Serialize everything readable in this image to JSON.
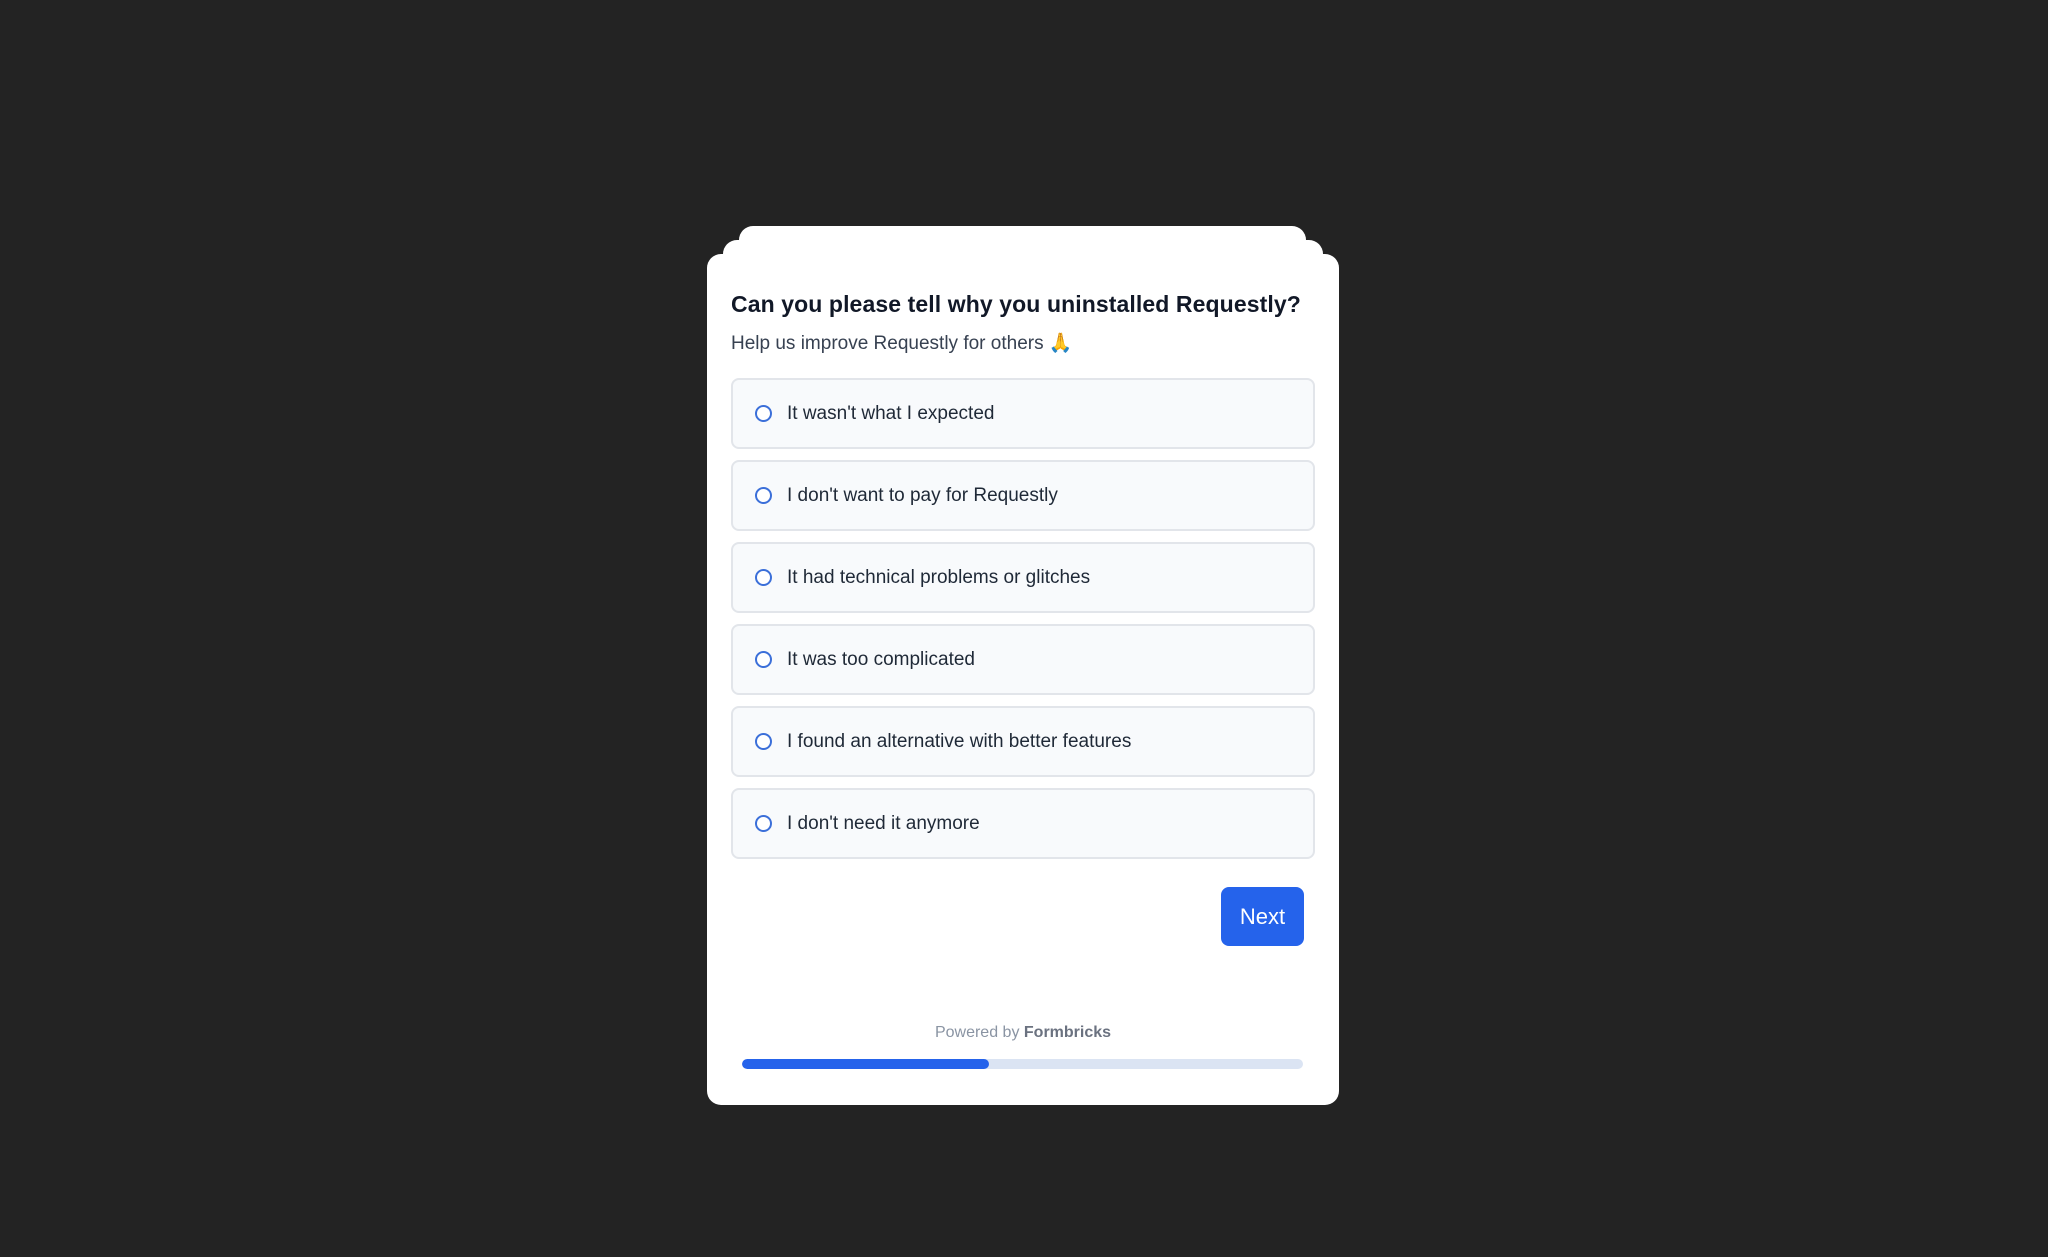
{
  "survey": {
    "question": "Can you please tell why you uninstalled Requestly?",
    "subheader": "Help us improve Requestly for others 🙏",
    "options": [
      {
        "label": "It wasn't what I expected"
      },
      {
        "label": "I don't want to pay for Requestly"
      },
      {
        "label": "It had technical problems or glitches"
      },
      {
        "label": "It was too complicated"
      },
      {
        "label": "I found an alternative with better features"
      },
      {
        "label": "I don't need it anymore"
      }
    ],
    "next_label": "Next"
  },
  "footer": {
    "powered_prefix": "Powered by",
    "powered_brand": "Formbricks"
  },
  "progress": {
    "fraction": 0.44
  },
  "colors": {
    "background": "#232323",
    "accent": "#2563eb",
    "progress_track": "#dbe4f3"
  }
}
